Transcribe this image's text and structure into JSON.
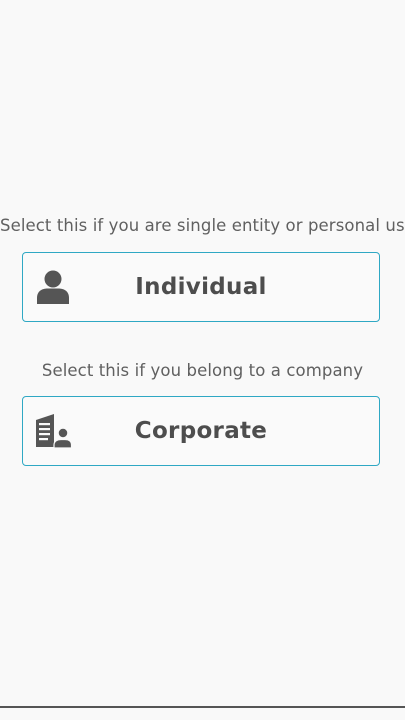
{
  "individual": {
    "hint": "Select this if you are single entity or personal use",
    "label": "Individual",
    "icon": "person-icon"
  },
  "corporate": {
    "hint": "Select this if you belong to a company",
    "label": "Corporate",
    "icon": "building-person-icon"
  },
  "colors": {
    "background": "#f9f9f9",
    "border_accent": "#2fa8c4",
    "text": "#4d4d4d",
    "hint_text": "#606060"
  }
}
